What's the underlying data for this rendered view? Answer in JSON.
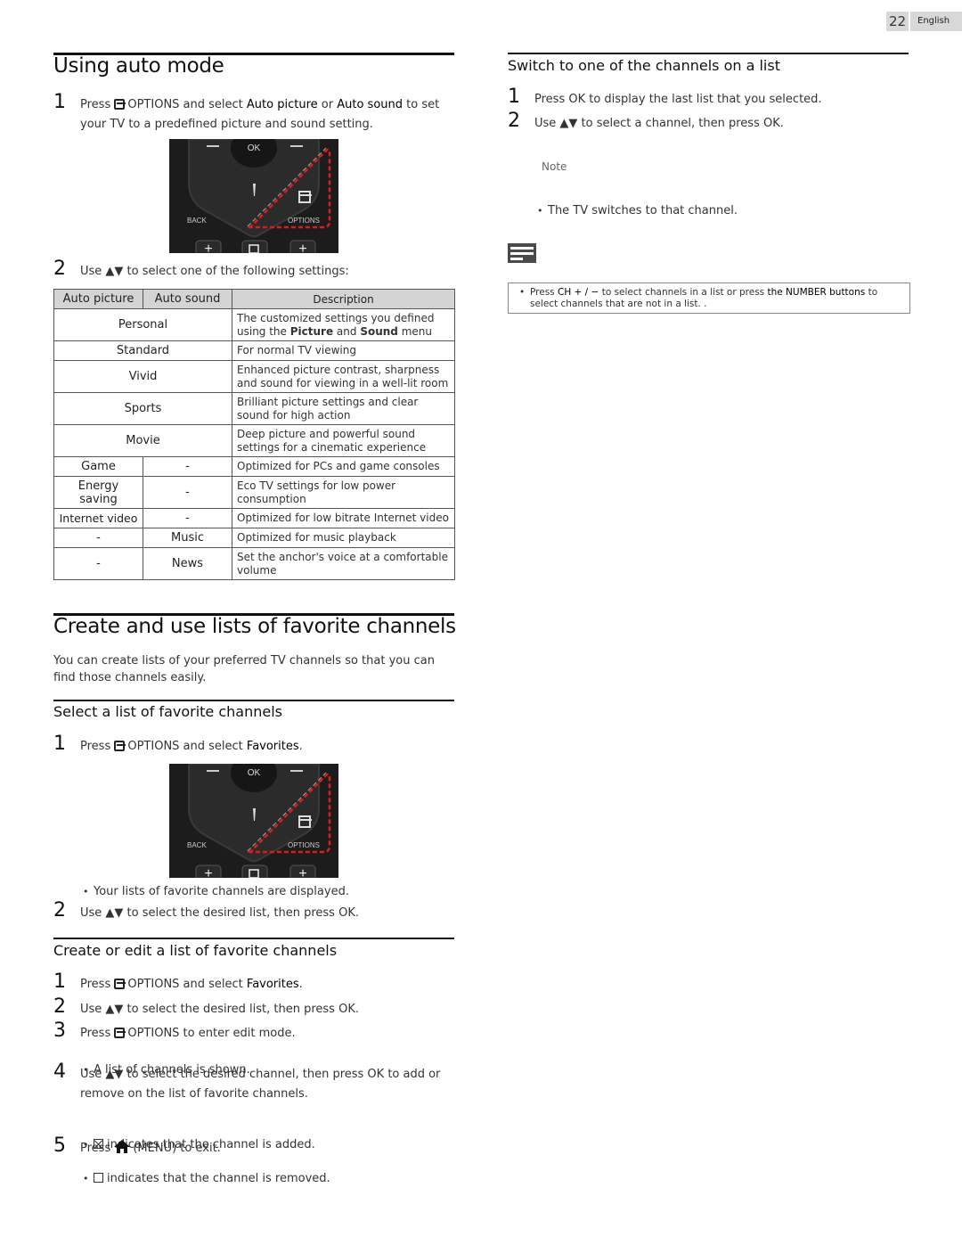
{
  "page": {
    "number": "22",
    "language": "English"
  },
  "auto_mode": {
    "title": "Using auto mode",
    "step1": {
      "num": "1",
      "pre": "Press",
      "icon": "options-icon",
      "options": "OPTIONS and select",
      "b1": "Auto picture",
      "or": "or",
      "b2": "Auto sound",
      "post": "to set your TV to a predefined picture and sound setting."
    },
    "remote": {
      "ok": "OK",
      "back": "BACK",
      "options": "OPTIONS"
    },
    "step2": {
      "num": "2",
      "text": "Use ▲▼ to select one of the following settings:"
    },
    "table": {
      "headers": [
        "Auto picture",
        "Auto sound",
        "Description"
      ],
      "rows": [
        {
          "merged": "Personal",
          "desc_parts": [
            "The customized settings you defined using the ",
            "Picture",
            " and ",
            "Sound",
            " menu"
          ]
        },
        {
          "merged": "Standard",
          "desc": "For normal TV viewing"
        },
        {
          "merged": "Vivid",
          "desc": "Enhanced picture contrast, sharpness and sound for viewing in a well-lit room"
        },
        {
          "merged": "Sports",
          "desc": "Brilliant picture settings and clear sound for high action"
        },
        {
          "merged": "Movie",
          "desc": "Deep picture and powerful sound settings for a cinematic experience"
        },
        {
          "picture": "Game",
          "sound": "-",
          "desc": "Optimized for PCs and game consoles"
        },
        {
          "picture": "Energy saving",
          "sound": "-",
          "desc": "Eco TV settings for low power consumption"
        },
        {
          "picture": "Internet video",
          "sound": "-",
          "desc": "Optimized for low bitrate Internet video"
        },
        {
          "picture": "-",
          "sound": "Music",
          "desc": "Optimized for music playback"
        },
        {
          "picture": "-",
          "sound": "News",
          "desc": "Set the anchor's voice at a comfortable volume"
        }
      ]
    }
  },
  "favorites": {
    "title": "Create and use lists of favorite channels",
    "intro": "You can create lists of your preferred TV channels so that you can find those channels easily.",
    "select": {
      "title": "Select a list of favorite channels",
      "step1": {
        "num": "1",
        "pre": "Press",
        "options": "OPTIONS and select",
        "b": "Favorites",
        "post": "."
      },
      "bullet": "Your lists of favorite channels are displayed.",
      "step2": {
        "num": "2",
        "text": "Use ▲▼ to select the desired list, then press OK."
      }
    },
    "edit": {
      "title": "Create or edit a list of favorite channels",
      "step1": {
        "num": "1",
        "pre": "Press",
        "options": "OPTIONS and select",
        "b": "Favorites",
        "post": "."
      },
      "step2": {
        "num": "2",
        "text": "Use ▲▼ to select the desired list, then press OK."
      },
      "step3": {
        "num": "3",
        "pre": "Press",
        "options": "OPTIONS to enter edit mode."
      },
      "step3_bullet": "A list of channels is shown.",
      "step4": {
        "num": "4",
        "text": "Use ▲▼ to select the desired channel, then press OK to add or remove on the list of favorite channels."
      },
      "step4_bullets": [
        "indicates that the channel is added.",
        "indicates that the channel is removed."
      ],
      "step5": {
        "num": "5",
        "pre": "Press",
        "post": "(MENU) to exit."
      }
    }
  },
  "switch": {
    "title": "Switch to one of the channels on a list",
    "step1": {
      "num": "1",
      "text": "Press OK to display the last list that you selected."
    },
    "step2": {
      "num": "2",
      "text": "Use ▲▼ to select a channel, then press OK."
    },
    "bullet": "The TV switches to that channel.",
    "note": {
      "label": "Note",
      "pre": "Press ",
      "b1": "CH + / −",
      "mid": " to select channels in a list or press ",
      "b2": "the NUMBER buttons",
      "post": " to select channels that are not in a list. ."
    }
  },
  "colors": {
    "highlight_dash": "#e01b1b",
    "remote_body": "#1c1c1c",
    "table_header": "#d4d4d4",
    "page_tab": "#d8d8d8"
  }
}
